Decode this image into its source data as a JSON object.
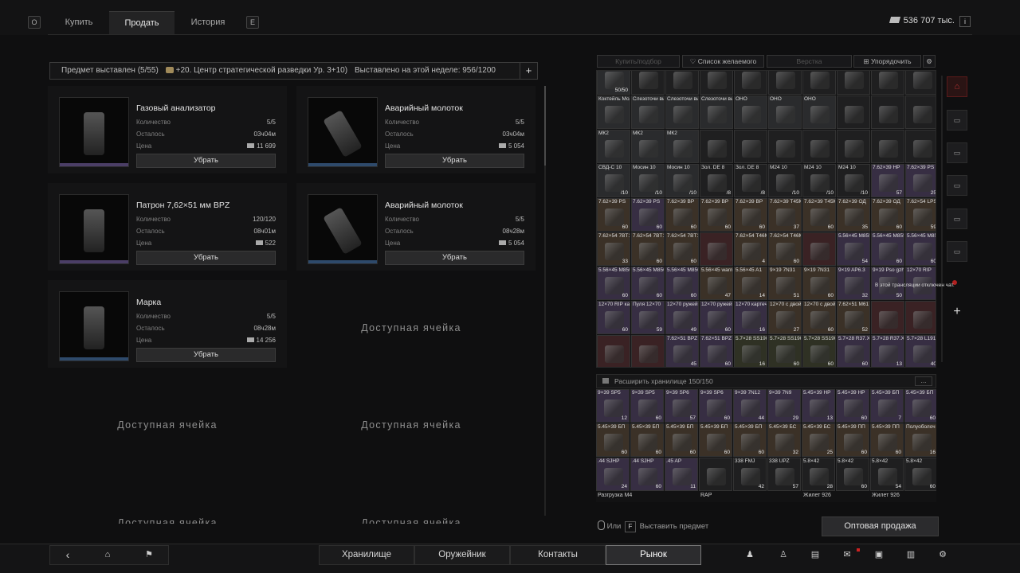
{
  "top": {
    "key_left": "O",
    "key_right": "E",
    "tabs": [
      {
        "label": "Купить"
      },
      {
        "label": "Продать"
      },
      {
        "label": "История"
      }
    ],
    "money": "536 707 тыс."
  },
  "offers_header": {
    "left": "Предмет выставлен (5/55)",
    "bonus": "+20. Центр стратегической разведки Ур. 3+10)",
    "week": "Выставлено на этой неделе: 956/1200",
    "add": "+"
  },
  "offers": [
    {
      "title": "Газовый анализатор",
      "qty_label": "Количество",
      "qty": "5/5",
      "left_label": "Осталось",
      "left": "03ч04м",
      "price_label": "Цена",
      "price": "11 699",
      "button": "Убрать",
      "bar_color": "#4b3e66"
    },
    {
      "title": "Аварийный молоток",
      "qty_label": "Количество",
      "qty": "5/5",
      "left_label": "Осталось",
      "left": "03ч04м",
      "price_label": "Цена",
      "price": "5 054",
      "button": "Убрать",
      "bar_color": "#2e4a6b"
    },
    {
      "title": "Патрон 7,62×51 мм BPZ",
      "qty_label": "Количество",
      "qty": "120/120",
      "left_label": "Осталось",
      "left": "08ч01м",
      "price_label": "Цена",
      "price": "522",
      "button": "Убрать",
      "bar_color": "#4b3e66"
    },
    {
      "title": "Аварийный молоток",
      "qty_label": "Количество",
      "qty": "5/5",
      "left_label": "Осталось",
      "left": "08ч28м",
      "price_label": "Цена",
      "price": "5 054",
      "button": "Убрать",
      "bar_color": "#2e4a6b"
    },
    {
      "title": "Марка",
      "qty_label": "Количество",
      "qty": "5/5",
      "left_label": "Осталось",
      "left": "08ч28м",
      "price_label": "Цена",
      "price": "14 256",
      "button": "Убрать",
      "bar_color": "#2e4a6b"
    }
  ],
  "empty_label": "Доступная ячейка",
  "toolbar": {
    "craft": "Купить/подбор",
    "wishlist": "Список желаемого",
    "verstka": "Верстка",
    "sort": "Упорядочить"
  },
  "grid": {
    "rows": [
      [
        [
          "",
          "50/50",
          "gray"
        ],
        [
          "",
          "",
          "dark"
        ],
        [
          "",
          "",
          "dark"
        ],
        [
          "",
          "",
          "dark"
        ],
        [
          "",
          "",
          "dark"
        ],
        [
          "",
          "",
          "dark"
        ],
        [
          "",
          "",
          "dark"
        ],
        [
          "",
          "",
          "dark"
        ],
        [
          "",
          "",
          "dark"
        ],
        [
          "",
          "",
          "dark"
        ]
      ],
      [
        [
          "Коктейль Молотова",
          "",
          "gray"
        ],
        [
          "Слезоточи вый газ",
          "",
          "gray"
        ],
        [
          "Слезоточи вый газ",
          "",
          "gray"
        ],
        [
          "Слезоточи вый газ",
          "",
          "gray"
        ],
        [
          "ОНО",
          "",
          "gray"
        ],
        [
          "ОНО",
          "",
          "gray"
        ],
        [
          "ОНО",
          "",
          "gray"
        ],
        [
          "",
          "",
          "dark"
        ],
        [
          "",
          "",
          "dark"
        ],
        [
          "",
          "",
          "dark"
        ]
      ],
      [
        [
          "МК2",
          "",
          "gray"
        ],
        [
          "МК2",
          "",
          "gray"
        ],
        [
          "МК2",
          "",
          "gray"
        ],
        [
          "",
          "",
          "dark"
        ],
        [
          "",
          "",
          "dark"
        ],
        [
          "",
          "",
          "dark"
        ],
        [
          "",
          "",
          "dark"
        ],
        [
          "",
          "",
          "dark"
        ],
        [
          "",
          "",
          "dark"
        ],
        [
          "",
          "",
          "dark"
        ]
      ],
      [
        [
          "СВД-С 10",
          "/10",
          "gray"
        ],
        [
          "Мосин 10",
          "/10",
          "gray"
        ],
        [
          "Мосин 10",
          "/10",
          "gray"
        ],
        [
          "Зол. DE 8",
          "/8",
          "dark"
        ],
        [
          "Зол. DE 8",
          "/8",
          "dark"
        ],
        [
          "M24 10",
          "/10",
          "dark"
        ],
        [
          "M24 10",
          "/10",
          "dark"
        ],
        [
          "M24 10",
          "/10",
          "dark"
        ],
        [
          "7.62×39 HP",
          "57",
          "purple"
        ],
        [
          "7.62×39 PS",
          "25",
          "purple"
        ]
      ],
      [
        [
          "7.62×39 PS",
          "60",
          "brown"
        ],
        [
          "7.62×39 PS",
          "60",
          "purple"
        ],
        [
          "7.62×39 BP",
          "60",
          "brown"
        ],
        [
          "7.62×39 BP",
          "60",
          "brown"
        ],
        [
          "7.62×39 BP",
          "60",
          "brown"
        ],
        [
          "7.62×39 T45M",
          "37",
          "brown"
        ],
        [
          "7.62×39 T45M",
          "60",
          "brown"
        ],
        [
          "7.62×39 ОД",
          "35",
          "brown"
        ],
        [
          "7.62×39 ОД",
          "60",
          "brown"
        ],
        [
          "7.62×54 LPS",
          "59",
          "brown"
        ]
      ],
      [
        [
          "7.62×54 7BT1",
          "33",
          "brown"
        ],
        [
          "7.62×54 7BT1",
          "60",
          "brown"
        ],
        [
          "7.62×54 7BT1",
          "60",
          "brown"
        ],
        [
          "",
          "",
          "red"
        ],
        [
          "7.62×54 T46M",
          "4",
          "brown"
        ],
        [
          "7.62×54 T46M",
          "60",
          "brown"
        ],
        [
          "",
          "",
          "red"
        ],
        [
          "5.56×45 M855",
          "54",
          "purple"
        ],
        [
          "5.56×45 M855",
          "60",
          "purple"
        ],
        [
          "5.56×45 M856",
          "60",
          "purple"
        ]
      ],
      [
        [
          "5.56×45 M856",
          "60",
          "purple"
        ],
        [
          "5.56×45 M856",
          "60",
          "purple"
        ],
        [
          "5.56×45 M856",
          "60",
          "purple"
        ],
        [
          "5.56×45 warmage",
          "47",
          "brown"
        ],
        [
          "5.56×45 A1",
          "14",
          "brown"
        ],
        [
          "9×19 7N31",
          "51",
          "brown"
        ],
        [
          "9×19 7N31",
          "60",
          "brown"
        ],
        [
          "9×19 AP6.3",
          "32",
          "purple"
        ],
        [
          "9×19 Pso gzh",
          "50",
          "purple"
        ],
        [
          "12×70 RIP",
          "",
          "purple"
        ]
      ],
      [
        [
          "12×70 RIP картечь",
          "60",
          "purple"
        ],
        [
          "Пуля 12×70",
          "59",
          "purple"
        ],
        [
          "12×70 ружейная пуля",
          "49",
          "purple"
        ],
        [
          "12×70 ружейная пуля",
          "60",
          "purple"
        ],
        [
          "12×70 картечь",
          "16",
          "purple"
        ],
        [
          "12×70 с двойной головкой",
          "27",
          "brown"
        ],
        [
          "12×70 с двойной головкой",
          "60",
          "brown"
        ],
        [
          "7.62×51 M61",
          "52",
          "brown"
        ],
        [
          "",
          "",
          "red"
        ],
        [
          "",
          "",
          "red"
        ]
      ],
      [
        [
          "",
          "",
          "red"
        ],
        [
          "",
          "",
          "red"
        ],
        [
          "7.62×51 BPZ",
          "45",
          "purple"
        ],
        [
          "7.62×51 BPZ",
          "60",
          "purple"
        ],
        [
          "5.7×28 SS190",
          "16",
          "olive"
        ],
        [
          "5.7×28 SS190",
          "60",
          "olive"
        ],
        [
          "5.7×28 SS190",
          "60",
          "olive"
        ],
        [
          "5.7×28 R37.X",
          "60",
          "purple"
        ],
        [
          "5.7×28 R37.X",
          "13",
          "purple"
        ],
        [
          "5.7×28 L191",
          "40",
          "purple"
        ]
      ]
    ]
  },
  "stash": {
    "title": "Расширить хранилище",
    "capacity": "150/150",
    "more": "...",
    "rows": [
      [
        [
          "9×39 SP5",
          "12",
          "purple"
        ],
        [
          "9×39 SP5",
          "60",
          "purple"
        ],
        [
          "9×39 SP6",
          "57",
          "purple"
        ],
        [
          "9×39 SP6",
          "60",
          "purple"
        ],
        [
          "9×39 7N12",
          "44",
          "purple"
        ],
        [
          "9×39 7N9",
          "29",
          "purple"
        ],
        [
          "5.45×39 HP",
          "13",
          "purple"
        ],
        [
          "5.45×39 HP",
          "60",
          "purple"
        ],
        [
          "5.45×39 БП",
          "7",
          "purple"
        ],
        [
          "5.45×39 БП",
          "60",
          "purple"
        ]
      ],
      [
        [
          "5.45×39 БП",
          "60",
          "brown"
        ],
        [
          "5.45×39 БП",
          "60",
          "brown"
        ],
        [
          "5.45×39 БП",
          "60",
          "brown"
        ],
        [
          "5.45×39 БП",
          "60",
          "brown"
        ],
        [
          "5.45×39 БП",
          "60",
          "brown"
        ],
        [
          "5.45×39 БС",
          "32",
          "brown"
        ],
        [
          "5.45×39 БС",
          "25",
          "brown"
        ],
        [
          "5.45×39 ПП",
          "60",
          "brown"
        ],
        [
          "5.45×39 ПП",
          "60",
          "brown"
        ],
        [
          "Полуоболоч ный",
          "16",
          "brown"
        ]
      ],
      [
        [
          ".44 SJHP",
          "24",
          "purple"
        ],
        [
          ".44 SJHP",
          "60",
          "purple"
        ],
        [
          ".45 AP",
          "11",
          "purple"
        ],
        [
          "",
          "",
          "dark"
        ],
        [
          "338 FMJ",
          "42",
          "dark"
        ],
        [
          "338 UPZ",
          "57",
          "dark"
        ],
        [
          "5.8×42",
          "28",
          "dark"
        ],
        [
          "5.8×42",
          "60",
          "dark"
        ],
        [
          "5.8×42",
          "54",
          "dark"
        ],
        [
          "5.8×42",
          "60",
          "dark"
        ]
      ]
    ],
    "bottom_labels": [
      "Разгрузка M4",
      "RAP",
      "Жилет 926",
      "Жилет 926",
      "Жилет 926"
    ]
  },
  "chat_notice": "В этой трансляции отключен чат.",
  "hint": {
    "or": "Или",
    "key": "F",
    "action": "Выставить предмет"
  },
  "bulk_sale": "Оптовая продажа",
  "bottom_nav": [
    {
      "label": "Хранилище"
    },
    {
      "label": "Оружейник"
    },
    {
      "label": "Контакты"
    },
    {
      "label": "Рынок"
    }
  ]
}
